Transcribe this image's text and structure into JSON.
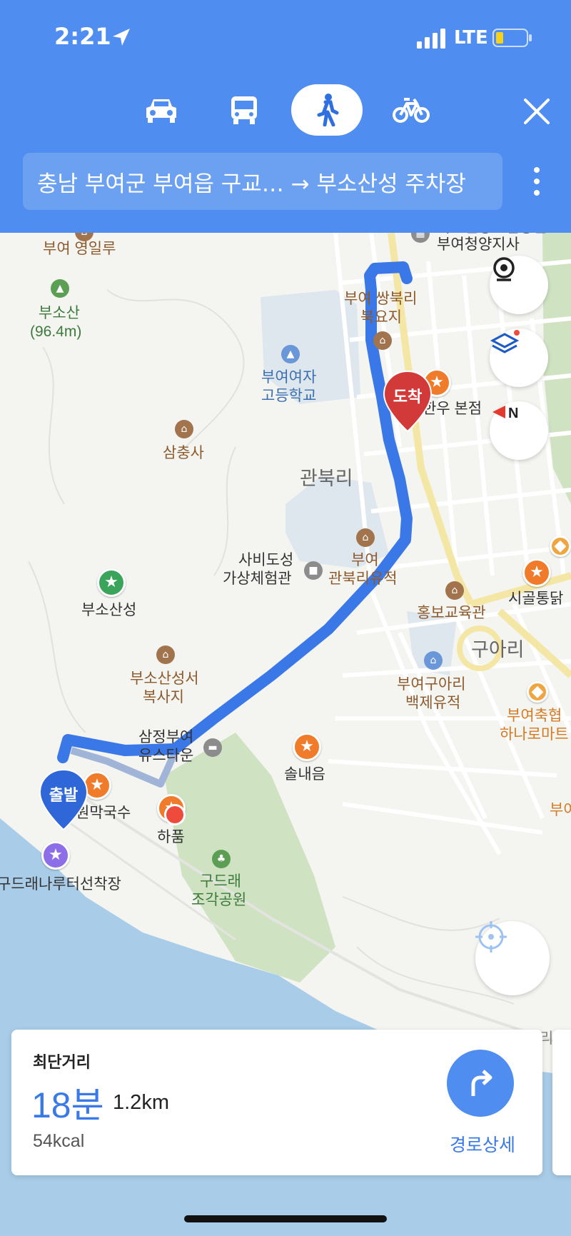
{
  "status_bar": {
    "time": "2:21",
    "network": "LTE"
  },
  "transport_modes": [
    {
      "name": "car",
      "icon": "car-icon",
      "active": false
    },
    {
      "name": "bus",
      "icon": "bus-icon",
      "active": false
    },
    {
      "name": "walk",
      "icon": "walk-icon",
      "active": true
    },
    {
      "name": "bike",
      "icon": "bike-icon",
      "active": false
    }
  ],
  "route": {
    "summary": "충남 부여군 부여읍 구교… → 부소산성 주차장"
  },
  "map": {
    "labels": {
      "buyeo_yeongillu": "부여 영일루",
      "busosan": "부소산",
      "busosan_height": "(96.4m)",
      "nhis": "국민건강보험공단",
      "nhis_branch": "부여청양지사",
      "ssangbukri_1": "부여 쌍북리",
      "ssangbukri_2": "북요지",
      "girls_high_1": "부여여자",
      "girls_high_2": "고등학교",
      "hanwoo": "한우 본점",
      "samchungsa": "삼충사",
      "gwanbukri": "관북리",
      "sabi_1": "사비도성",
      "sabi_2": "가상체험관",
      "gwanbukri_site_1": "부여",
      "gwanbukri_site_2": "관북리유적",
      "busosanseong": "부소산성",
      "hongbo": "홍보교육관",
      "sigol": "시골통닭",
      "guari": "구아리",
      "guari_site_1": "부여구아리",
      "guari_site_2": "백제유적",
      "busosan_temple_1": "부소산성서",
      "busosan_temple_2": "복사지",
      "festival_1": "부여축협",
      "festival_2": "하나로마트",
      "youth_1": "삼정부여",
      "youth_2": "유스타운",
      "solnaeeum": "솔내음",
      "makguksu": "원막국수",
      "hapum": "하품",
      "buyeo_edge": "부여",
      "ferry": "구드래나루터선착장",
      "park_1": "구드래",
      "park_2": "조각공원",
      "edge_text": "리"
    },
    "markers": {
      "start": "출발",
      "end": "도착"
    }
  },
  "route_card": {
    "type": "최단거리",
    "duration": "18분",
    "distance": "1.2km",
    "calories": "54kcal",
    "detail_label": "경로상세"
  },
  "colors": {
    "header": "#4f8ef0",
    "route": "#3b78e7",
    "accent": "#3a7ae8"
  }
}
